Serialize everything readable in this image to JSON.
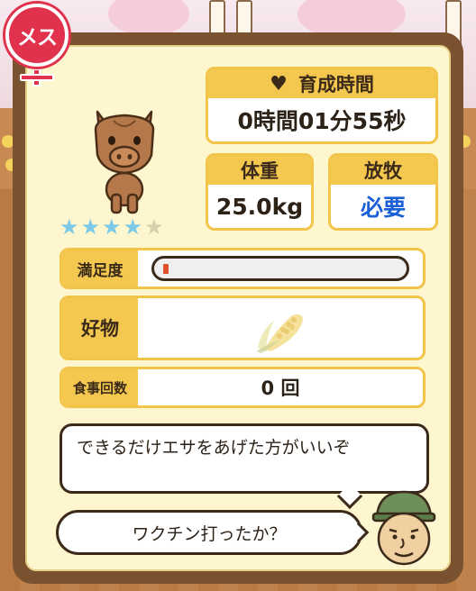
{
  "gender": {
    "label": "メス",
    "color": "#e0324c"
  },
  "rating": {
    "filled": 4,
    "total": 5
  },
  "growth_time": {
    "label": "育成時間",
    "value": "0時間01分55秒"
  },
  "weight": {
    "label": "体重",
    "value": "25.0kg"
  },
  "grazing": {
    "label": "放牧",
    "value": "必要",
    "value_color": "#1a5fd6"
  },
  "satisfaction": {
    "label": "満足度",
    "level": 0.02
  },
  "favorite": {
    "label": "好物",
    "item_icon": "corn-icon"
  },
  "meal_count": {
    "label": "食事回数",
    "value": "0 回"
  },
  "advice": {
    "message": "できるだけエサをあげた方がいいぞ",
    "question": "ワクチン打ったか？"
  },
  "colors": {
    "panel": "#7a5230",
    "header": "#f4c84e",
    "background": "#fdf6cf"
  }
}
